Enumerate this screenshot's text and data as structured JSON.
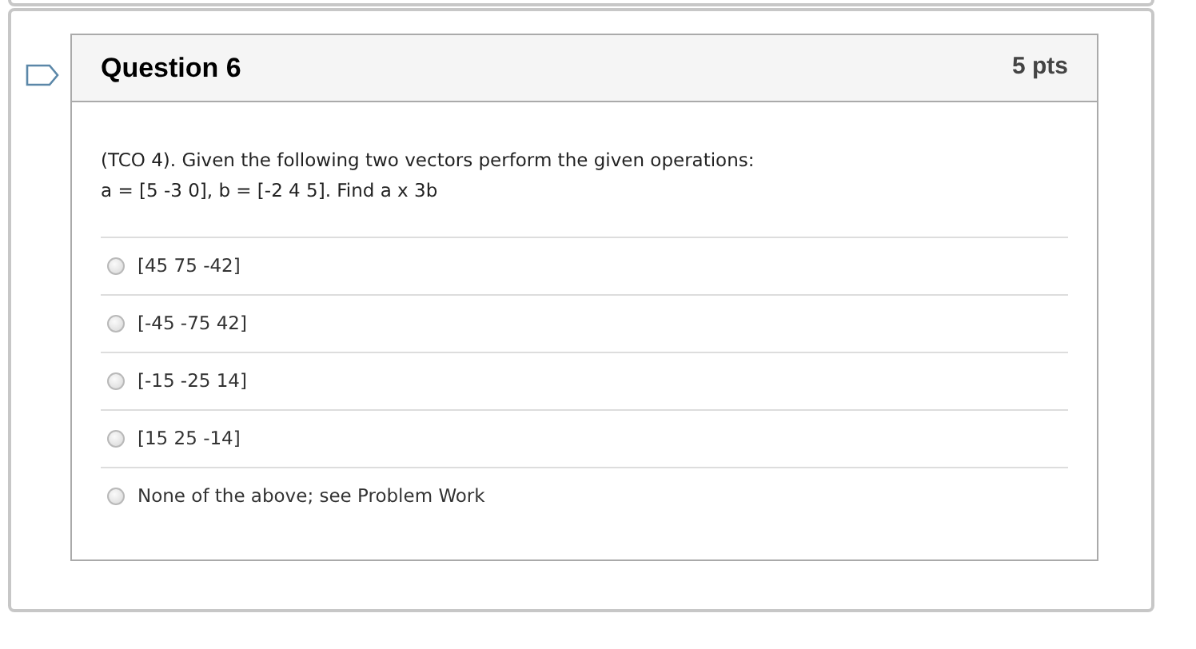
{
  "question": {
    "title": "Question 6",
    "points": "5 pts",
    "flagged": false,
    "prompt": [
      "(TCO 4). Given the following two vectors perform the given operations:",
      "a = [5 -3 0], b = [-2 4 5]. Find a x 3b"
    ],
    "answers": [
      {
        "label": "[45 75 -42]",
        "selected": false
      },
      {
        "label": "[-45 -75 42]",
        "selected": false
      },
      {
        "label": "[-15 -25 14]",
        "selected": false
      },
      {
        "label": "[15 25 -14]",
        "selected": false
      },
      {
        "label": "None of the above; see Problem Work",
        "selected": false
      }
    ]
  }
}
